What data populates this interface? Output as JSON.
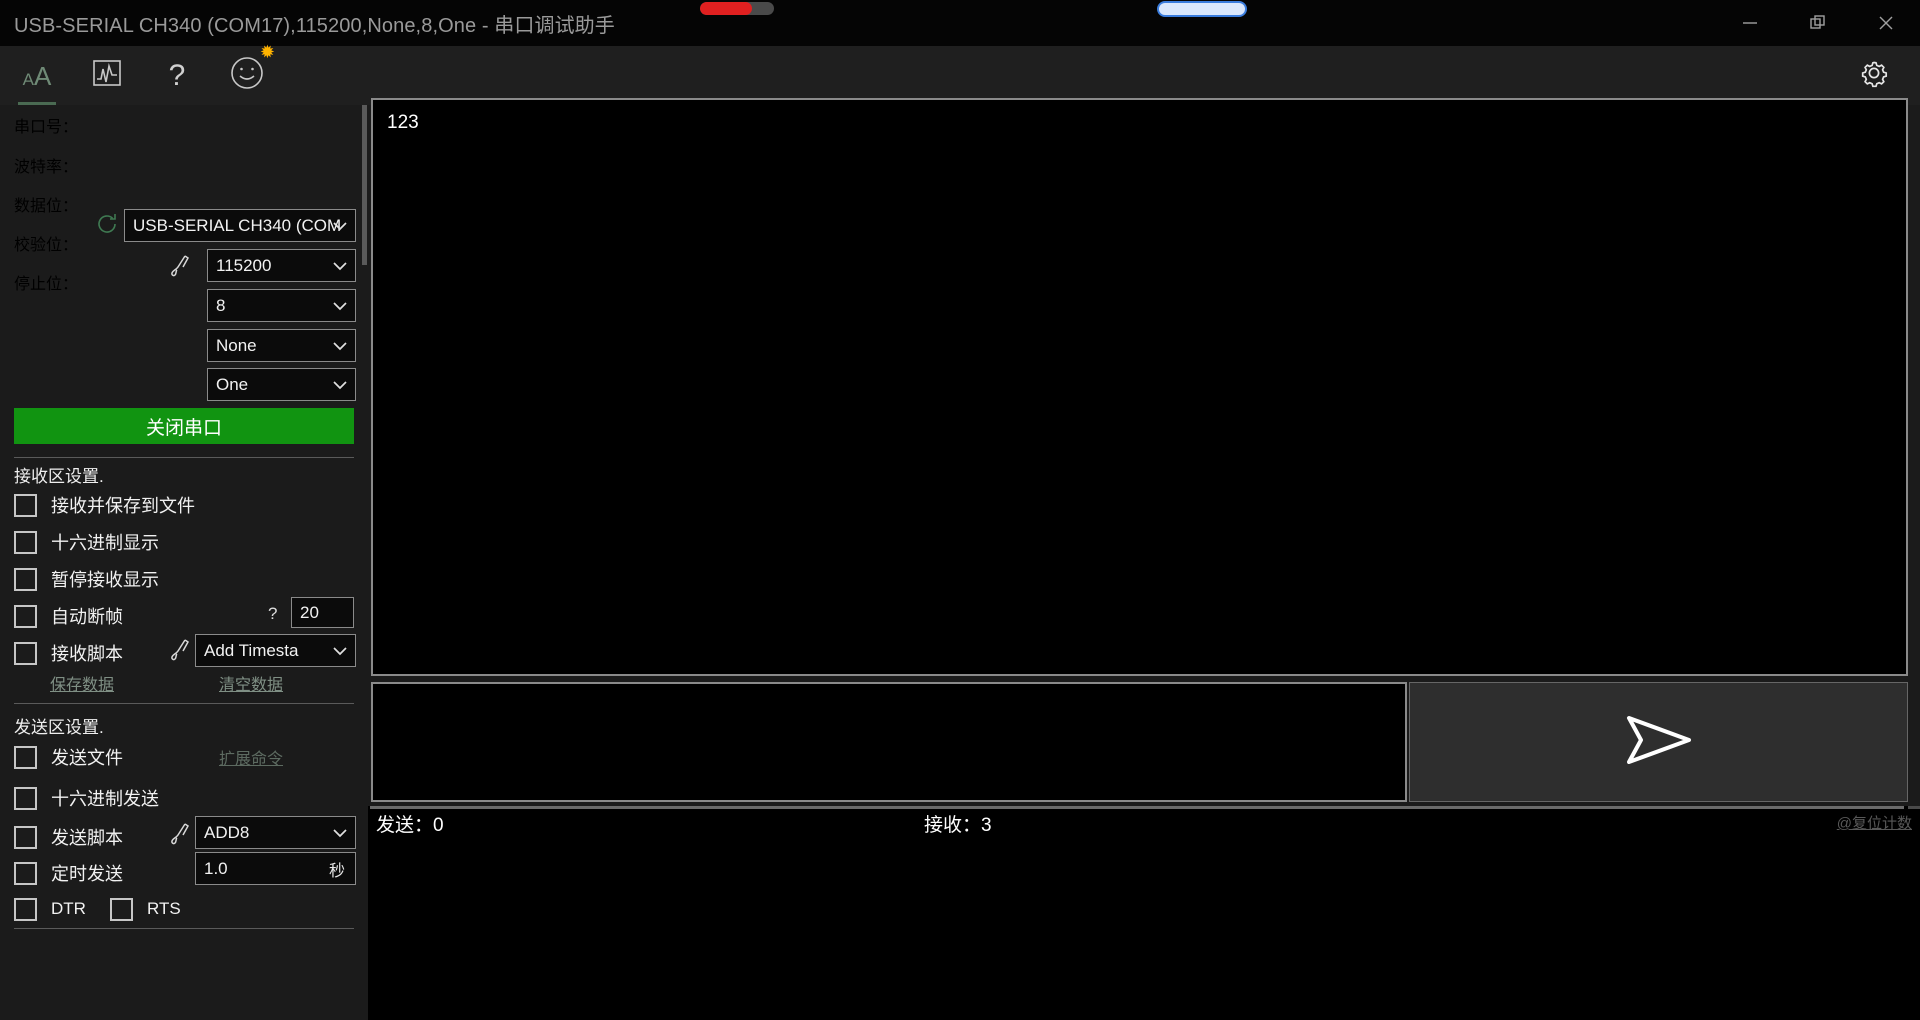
{
  "window": {
    "title": "USB-SERIAL CH340 (COM17),115200,None,8,One - 串口调试助手",
    "minimize_label": "minimize",
    "restore_label": "restore",
    "close_label": "close",
    "progress_red_percent": 70,
    "accent_red": "#e02020",
    "accent_blue": "#3b7ddd"
  },
  "toolbar": {
    "font_icon": "font-size-icon",
    "chart_icon": "waveform-icon",
    "help_icon": "?",
    "smiley_icon": "smiley-icon",
    "gear_icon": "gear-icon"
  },
  "serial": {
    "port_label": "串口号：",
    "port_value": "USB-SERIAL CH340 (COM",
    "baud_label": "波特率：",
    "baud_value": "115200",
    "data_label": "数据位：",
    "data_value": "8",
    "parity_label": "校验位：",
    "parity_value": "None",
    "stop_label": "停止位：",
    "stop_value": "One",
    "open_button": "关闭串口",
    "open_button_color": "#119411"
  },
  "receive_settings": {
    "title": "接收区设置.",
    "items": [
      {
        "label": "接收并保存到文件",
        "checked": false
      },
      {
        "label": "十六进制显示",
        "checked": false
      },
      {
        "label": "暂停接收显示",
        "checked": false
      },
      {
        "label": "自动断帧",
        "checked": false
      },
      {
        "label": "接收脚本",
        "checked": false
      }
    ],
    "auto_frame_hint": "?",
    "auto_frame_value": "20",
    "script_value": "Add Timesta",
    "save_link": "保存数据",
    "clear_link": "清空数据"
  },
  "send_settings": {
    "title": "发送区设置.",
    "items": [
      {
        "label": "发送文件",
        "checked": false
      },
      {
        "label": "十六进制发送",
        "checked": false
      },
      {
        "label": "发送脚本",
        "checked": false
      },
      {
        "label": "定时发送",
        "checked": false
      }
    ],
    "extend_link": "扩展命令",
    "script_value": "ADD8",
    "timer_value": "1.0",
    "timer_unit": "秒",
    "dtr_label": "DTR",
    "dtr_checked": false,
    "rts_label": "RTS",
    "rts_checked": false
  },
  "main": {
    "receive_text": "123",
    "send_text": "",
    "send_icon": "paper-plane-icon"
  },
  "status": {
    "sent_label": "发送：0",
    "received_label": "接收：3",
    "watermark": "@复位计数"
  }
}
